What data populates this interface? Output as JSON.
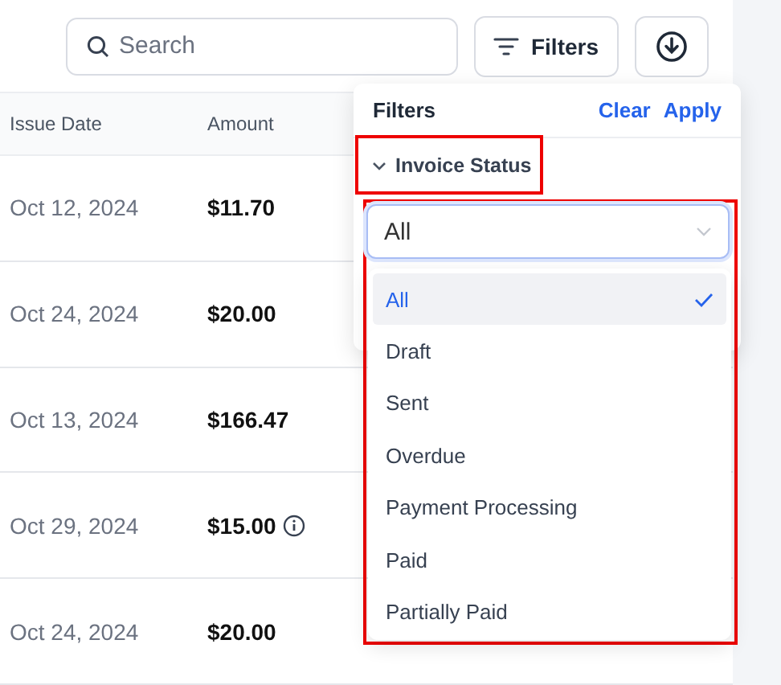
{
  "toolbar": {
    "search": {
      "placeholder": "Search"
    },
    "filters_button": "Filters"
  },
  "table": {
    "columns": [
      "Issue Date",
      "Amount"
    ],
    "rows": [
      {
        "issue_date": "Oct 12, 2024",
        "amount": "$11.70",
        "info": false
      },
      {
        "issue_date": "Oct 24, 2024",
        "amount": "$20.00",
        "info": false
      },
      {
        "issue_date": "Oct 13, 2024",
        "amount": "$166.47",
        "info": false
      },
      {
        "issue_date": "Oct 29, 2024",
        "amount": "$15.00",
        "info": true
      },
      {
        "issue_date": "Oct 24, 2024",
        "amount": "$20.00",
        "info": false
      }
    ]
  },
  "filters_panel": {
    "title": "Filters",
    "actions": [
      "Clear",
      "Apply"
    ],
    "section": {
      "label": "Invoice Status",
      "expanded": true,
      "highlighted": true
    },
    "select": {
      "value": "All",
      "highlighted": true,
      "options": [
        {
          "label": "All",
          "selected": true
        },
        {
          "label": "Draft",
          "selected": false
        },
        {
          "label": "Sent",
          "selected": false
        },
        {
          "label": "Overdue",
          "selected": false
        },
        {
          "label": "Payment Processing",
          "selected": false
        },
        {
          "label": "Paid",
          "selected": false
        },
        {
          "label": "Partially Paid",
          "selected": false
        }
      ]
    }
  }
}
